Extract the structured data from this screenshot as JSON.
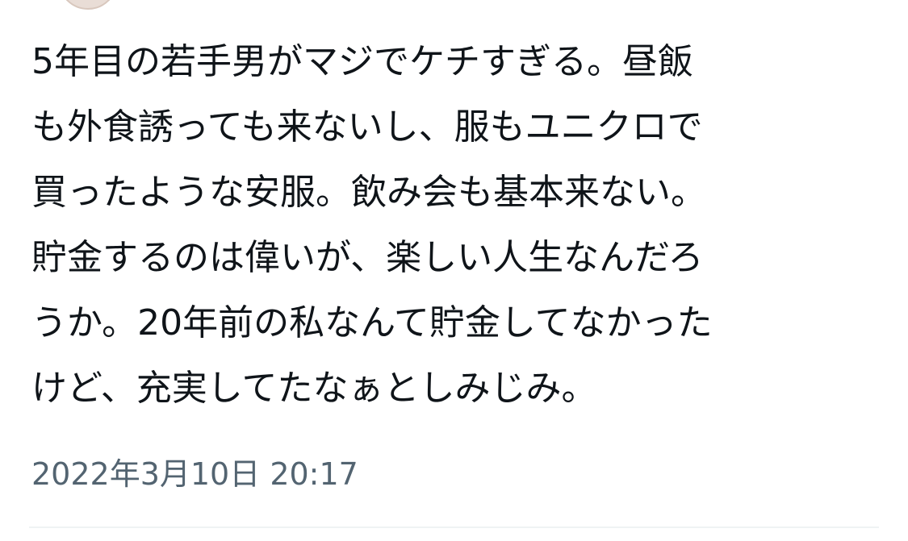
{
  "tweet": {
    "text": "5年目の若手男がマジでケチすぎる。昼飯\nも外食誘っても来ないし、服もユニクロで\n買ったような安服。飲み会も基本来ない。\n貯金するのは偉いが、楽しい人生なんだろ\nうか。20年前の私なんて貯金してなかった\nけど、充実してたなぁとしみじみ。",
    "timestamp": "2022年3月10日 20:17"
  }
}
